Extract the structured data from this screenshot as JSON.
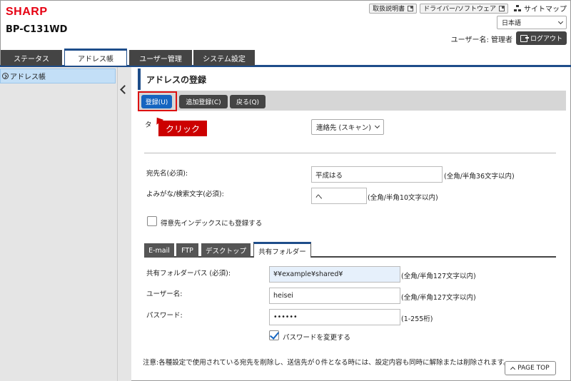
{
  "header": {
    "brand": "SHARP",
    "model": "BP-C131WD",
    "links": [
      {
        "label": "取扱説明書"
      },
      {
        "label": "ドライバー/ソフトウェア"
      }
    ],
    "sitemap": "サイトマップ",
    "language": "日本語",
    "user_label": "ユーザー名: 管理者",
    "logout": "ログアウト"
  },
  "tabs": [
    {
      "label": "ステータス",
      "active": false
    },
    {
      "label": "アドレス帳",
      "active": true
    },
    {
      "label": "ユーザー管理",
      "active": false
    },
    {
      "label": "システム設定",
      "active": false
    }
  ],
  "sidebar": {
    "items": [
      {
        "label": "アドレス帳",
        "selected": true
      }
    ]
  },
  "page": {
    "title": "アドレスの登録",
    "buttons": {
      "register": "登録(U)",
      "add_register": "追加登録(C)",
      "back": "戻る(Q)"
    },
    "callout": "クリック",
    "type_label_partial": "タ",
    "type_value": "連絡先 (スキャン)",
    "name_label": "宛先名(必須):",
    "name_value": "平成はる",
    "name_hint": "(全角/半角36文字以内)",
    "kana_label": "よみがな/検索文字(必須):",
    "kana_value": "へ",
    "kana_hint": "(全角/半角10文字以内)",
    "favorite_label": "得意先インデックスにも登録する",
    "favorite_checked": false,
    "subtabs": [
      {
        "label": "E-mail",
        "active": false
      },
      {
        "label": "FTP",
        "active": false
      },
      {
        "label": "デスクトップ",
        "active": false
      },
      {
        "label": "共有フォルダー",
        "active": true
      }
    ],
    "folder_path_label": "共有フォルダーパス (必須):",
    "folder_path_value": "¥¥example¥shared¥",
    "folder_path_hint": "(全角/半角127文字以内)",
    "username_label": "ユーザー名:",
    "username_value": "heisei",
    "username_hint": "(全角/半角127文字以内)",
    "password_label": "パスワード:",
    "password_value": "••••••",
    "password_hint": "(1-255桁)",
    "change_password_label": "パスワードを変更する",
    "change_password_checked": true,
    "note": "注意:各種設定で使用されている宛先を削除し、送信先が０件となる時には、設定内容も同時に解除または削除されます。",
    "page_top": "PAGE TOP"
  }
}
